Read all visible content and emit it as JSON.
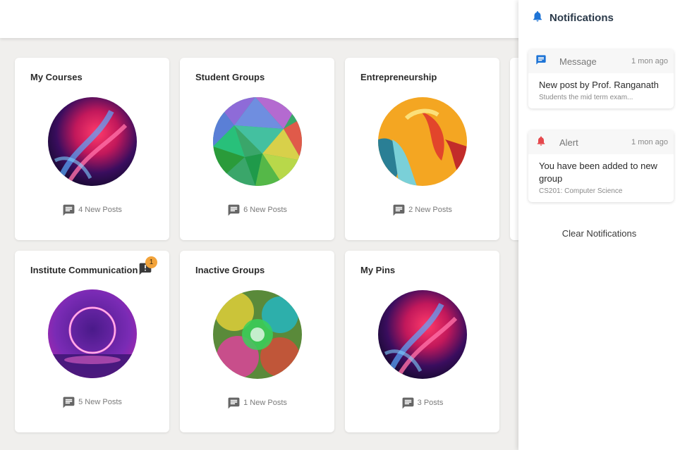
{
  "cards": [
    {
      "title": "My Courses",
      "posts": "4 New Posts"
    },
    {
      "title": "Student Groups",
      "posts": "6 New Posts"
    },
    {
      "title": "Entrepreneurship",
      "posts": "2 New Posts"
    },
    {
      "title": "Institute Communication",
      "posts": "5 New Posts",
      "badge": "1"
    },
    {
      "title": "Inactive Groups",
      "posts": "1 New Posts"
    },
    {
      "title": "My Pins",
      "posts": "3 Posts"
    }
  ],
  "notifications": {
    "title": "Notifications",
    "items": [
      {
        "type": "Message",
        "time": "1 mon ago",
        "title": "New post by Prof. Ranganath",
        "subtitle": "Students the mid term exam..."
      },
      {
        "type": "Alert",
        "time": "1 mon ago",
        "title": "You have been added to new group",
        "subtitle": "CS201: Computer Science"
      }
    ],
    "clear_label": "Clear Notifications"
  },
  "colors": {
    "accent_blue": "#1e74d6",
    "alert_red": "#e5484d",
    "badge_orange": "#f2a33a",
    "icon_gray": "#666666"
  },
  "icons": {
    "bell": "bell-icon",
    "message": "message-icon",
    "alert": "alert-bell-icon",
    "posts": "chat-icon",
    "announcement": "announcement-icon"
  }
}
